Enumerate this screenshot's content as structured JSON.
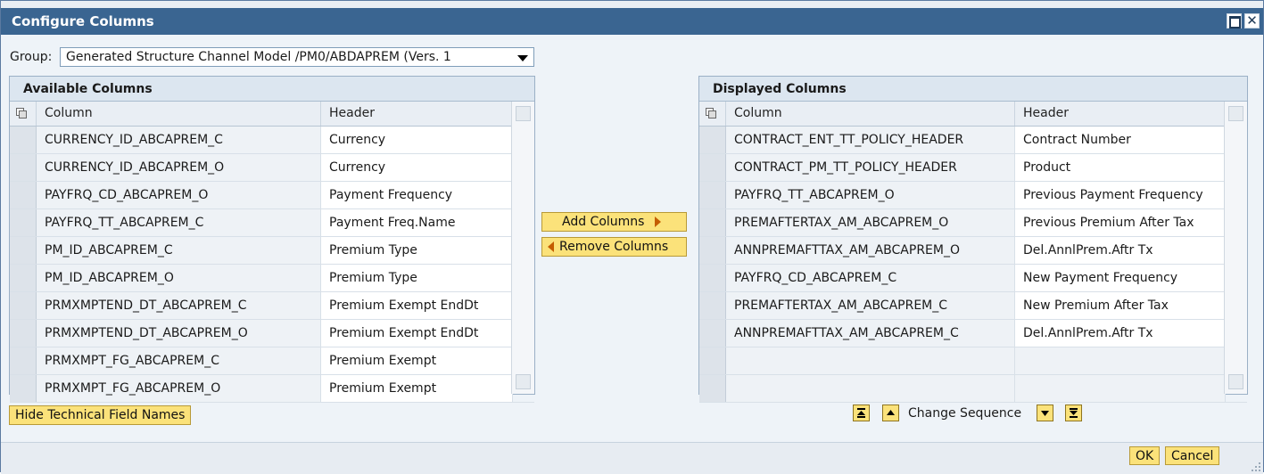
{
  "dialog": {
    "title": "Configure Columns"
  },
  "group": {
    "label": "Group:",
    "value": "Generated Structure Channel Model /PM0/ABDAPREM (Vers. 1"
  },
  "available": {
    "title": "Available Columns",
    "col_header": "Column",
    "hdr_header": "Header",
    "rows": [
      {
        "column": "CURRENCY_ID_ABCAPREM_C",
        "header": "Currency"
      },
      {
        "column": "CURRENCY_ID_ABCAPREM_O",
        "header": "Currency"
      },
      {
        "column": "PAYFRQ_CD_ABCAPREM_O",
        "header": "Payment Frequency"
      },
      {
        "column": "PAYFRQ_TT_ABCAPREM_C",
        "header": "Payment Freq.Name"
      },
      {
        "column": "PM_ID_ABCAPREM_C",
        "header": "Premium Type"
      },
      {
        "column": "PM_ID_ABCAPREM_O",
        "header": "Premium Type"
      },
      {
        "column": "PRMXMPTEND_DT_ABCAPREM_C",
        "header": "Premium Exempt EndDt"
      },
      {
        "column": "PRMXMPTEND_DT_ABCAPREM_O",
        "header": "Premium Exempt EndDt"
      },
      {
        "column": "PRMXMPT_FG_ABCAPREM_C",
        "header": "Premium Exempt"
      },
      {
        "column": "PRMXMPT_FG_ABCAPREM_O",
        "header": "Premium Exempt"
      }
    ]
  },
  "displayed": {
    "title": "Displayed Columns",
    "col_header": "Column",
    "hdr_header": "Header",
    "rows": [
      {
        "column": "CONTRACT_ENT_TT_POLICY_HEADER",
        "header": "Contract Number"
      },
      {
        "column": "CONTRACT_PM_TT_POLICY_HEADER",
        "header": "Product"
      },
      {
        "column": "PAYFRQ_TT_ABCAPREM_O",
        "header": "Previous Payment Frequency"
      },
      {
        "column": "PREMAFTERTAX_AM_ABCAPREM_O",
        "header": "Previous Premium After Tax"
      },
      {
        "column": "ANNPREMAFTTAX_AM_ABCAPREM_O",
        "header": "Del.AnnlPrem.Aftr Tx"
      },
      {
        "column": "PAYFRQ_CD_ABCAPREM_C",
        "header": "New Payment Frequency"
      },
      {
        "column": "PREMAFTERTAX_AM_ABCAPREM_C",
        "header": "New Premium After Tax"
      },
      {
        "column": "ANNPREMAFTTAX_AM_ABCAPREM_C",
        "header": "Del.AnnlPrem.Aftr Tx"
      },
      {
        "column": "",
        "header": ""
      },
      {
        "column": "",
        "header": ""
      }
    ]
  },
  "buttons": {
    "add": "Add Columns",
    "remove": "Remove Columns",
    "hide_tech": "Hide Technical Field Names",
    "change_sequence": "Change Sequence",
    "ok": "OK",
    "cancel": "Cancel"
  },
  "colors": {
    "title_bar": "#3a6591",
    "button_bg": "#fbe27a",
    "arrow": "#c45d00"
  }
}
